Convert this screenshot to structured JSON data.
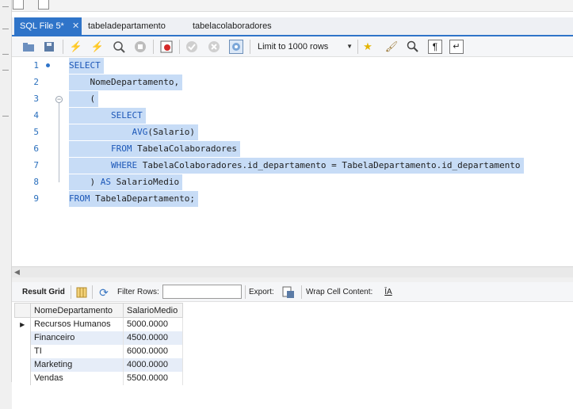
{
  "tabs": [
    {
      "label": "SQL File 5*",
      "active": true
    },
    {
      "label": "tabeladepartamento",
      "active": false
    },
    {
      "label": "tabelacolaboradores",
      "active": false
    }
  ],
  "toolbar": {
    "limit_label": "Limit to 1000 rows",
    "icons": [
      "open-folder-icon",
      "save-icon",
      "execute-icon",
      "execute-selection-icon",
      "explain-icon",
      "stop-icon",
      "toggle-continue-on-error-icon",
      "commit-icon",
      "rollback-icon",
      "autocommit-icon",
      "limit-dropdown",
      "bookmark-icon",
      "beautify-icon",
      "find-icon",
      "invisible-chars-icon",
      "wrap-icon"
    ]
  },
  "editor": {
    "lines": [
      {
        "n": "1",
        "indent": 0,
        "parts": [
          {
            "t": "SELECT",
            "kw": true
          }
        ]
      },
      {
        "n": "2",
        "indent": 1,
        "parts": [
          {
            "t": "NomeDepartamento,",
            "kw": false
          }
        ]
      },
      {
        "n": "3",
        "indent": 1,
        "parts": [
          {
            "t": "(",
            "kw": false
          }
        ]
      },
      {
        "n": "4",
        "indent": 2,
        "parts": [
          {
            "t": "SELECT",
            "kw": true
          }
        ]
      },
      {
        "n": "5",
        "indent": 3,
        "parts": [
          {
            "t": "AVG",
            "kw": true
          },
          {
            "t": "(Salario)",
            "kw": false
          }
        ]
      },
      {
        "n": "6",
        "indent": 2,
        "parts": [
          {
            "t": "FROM",
            "kw": true
          },
          {
            "t": " TabelaColaboradores",
            "kw": false
          }
        ]
      },
      {
        "n": "7",
        "indent": 2,
        "parts": [
          {
            "t": "WHERE",
            "kw": true
          },
          {
            "t": " TabelaColaboradores.id_departamento = TabelaDepartamento.id_departamento",
            "kw": false
          }
        ]
      },
      {
        "n": "8",
        "indent": 1,
        "parts": [
          {
            "t": ") ",
            "kw": false
          },
          {
            "t": "AS",
            "kw": true
          },
          {
            "t": " SalarioMedio",
            "kw": false
          }
        ]
      },
      {
        "n": "9",
        "indent": 0,
        "parts": [
          {
            "t": "FROM",
            "kw": true
          },
          {
            "t": " TabelaDepartamento;",
            "kw": false
          }
        ]
      }
    ]
  },
  "results_toolbar": {
    "result_grid_label": "Result Grid",
    "filter_label": "Filter Rows:",
    "filter_value": "",
    "export_label": "Export:",
    "wrap_label": "Wrap Cell Content:"
  },
  "grid": {
    "columns": [
      "NomeDepartamento",
      "SalarioMedio"
    ],
    "rows": [
      [
        "Recursos Humanos",
        "5000.0000"
      ],
      [
        "Financeiro",
        "4500.0000"
      ],
      [
        "TI",
        "6000.0000"
      ],
      [
        "Marketing",
        "4000.0000"
      ],
      [
        "Vendas",
        "5500.0000"
      ]
    ]
  },
  "colors": {
    "accent": "#2f74c9",
    "selection": "#c7dcf6",
    "keyword": "#1d58b8",
    "line_number": "#2a6fbd"
  }
}
